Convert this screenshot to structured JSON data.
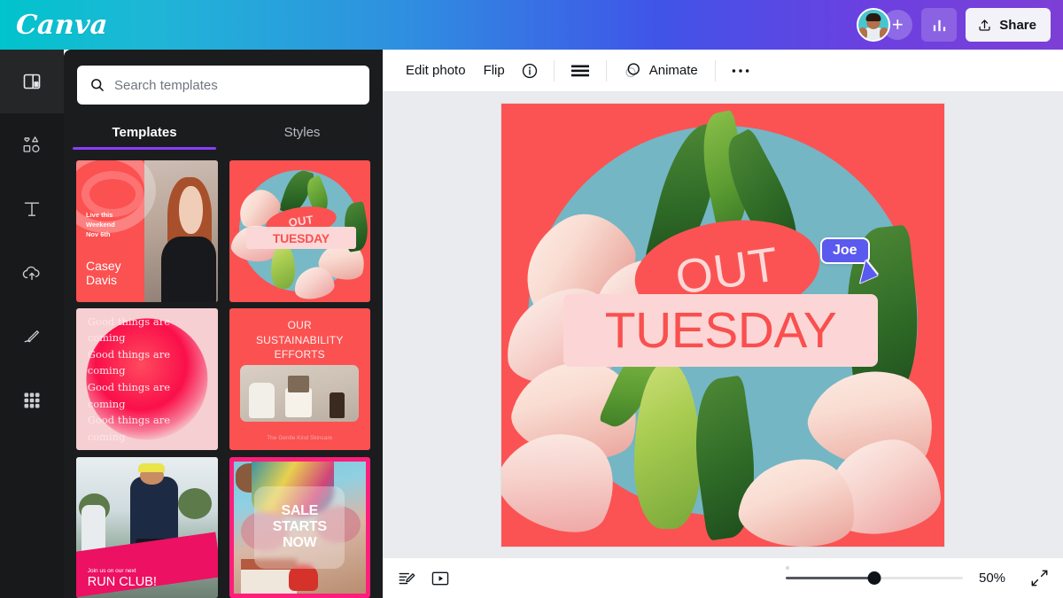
{
  "header": {
    "logo": "Canva",
    "avatar_name": "user-avatar",
    "add_label": "+",
    "insights_icon": "bar-chart-icon",
    "share_label": "Share",
    "share_icon": "upload-icon",
    "gradient_from": "#00c4cc",
    "gradient_to": "#7d3fd6"
  },
  "rail": {
    "items": [
      {
        "name": "design",
        "icon": "layout-panel-icon",
        "active": true
      },
      {
        "name": "elements",
        "icon": "shapes-icon",
        "active": false
      },
      {
        "name": "text",
        "icon": "text-t-icon",
        "active": false
      },
      {
        "name": "uploads",
        "icon": "cloud-upload-icon",
        "active": false
      },
      {
        "name": "draw",
        "icon": "pen-icon",
        "active": false
      },
      {
        "name": "apps",
        "icon": "grid-apps-icon",
        "active": false
      }
    ]
  },
  "panel": {
    "search": {
      "placeholder": "Search templates",
      "value": "",
      "icon": "search-icon"
    },
    "tabs": [
      {
        "label": "Templates",
        "active": true
      },
      {
        "label": "Styles",
        "active": false
      }
    ],
    "templates": [
      {
        "id": "casey-davis",
        "small_line1": "Live this",
        "small_line2": "Weekend",
        "small_line3": "Nov 6th",
        "name_line1": "Casey",
        "name_line2": "Davis"
      },
      {
        "id": "out-tuesday",
        "word_top": "OUT",
        "word_bottom": "TUESDAY"
      },
      {
        "id": "good-things",
        "line": "Good things are coming",
        "repeat": 4
      },
      {
        "id": "sustainability",
        "title_line1": "OUR",
        "title_line2": "SUSTAINABILITY",
        "title_line3": "EFFORTS",
        "caption": "The Gentle Kind Skincare"
      },
      {
        "id": "run-club",
        "kicker": "Join us on our next",
        "headline": "RUN CLUB!"
      },
      {
        "id": "sale-starts-now",
        "line1": "SALE",
        "line2": "STARTS",
        "line3": "NOW"
      }
    ]
  },
  "toolbar": {
    "edit_photo": "Edit photo",
    "flip": "Flip",
    "info_icon": "info-circle-icon",
    "position_icon": "position-lines-icon",
    "animate": "Animate",
    "animate_icon": "animate-circles-icon",
    "more_icon": "more-horizontal-icon"
  },
  "canvas": {
    "background_color": "#fb5353",
    "circle_color": "#74b6c4",
    "word_top": "OUT",
    "word_top_color": "#fcd8d8",
    "word_bottom": "TUESDAY",
    "word_bottom_color": "#f9504f",
    "word_bottom_bg": "#fcd6d6"
  },
  "collaborator": {
    "name": "Joe",
    "color": "#5a5aef"
  },
  "bottom": {
    "notes_icon": "notes-pencil-icon",
    "present_icon": "present-play-icon",
    "zoom_value": "50%",
    "zoom_percent": 50,
    "fullscreen_icon": "expand-icon"
  }
}
